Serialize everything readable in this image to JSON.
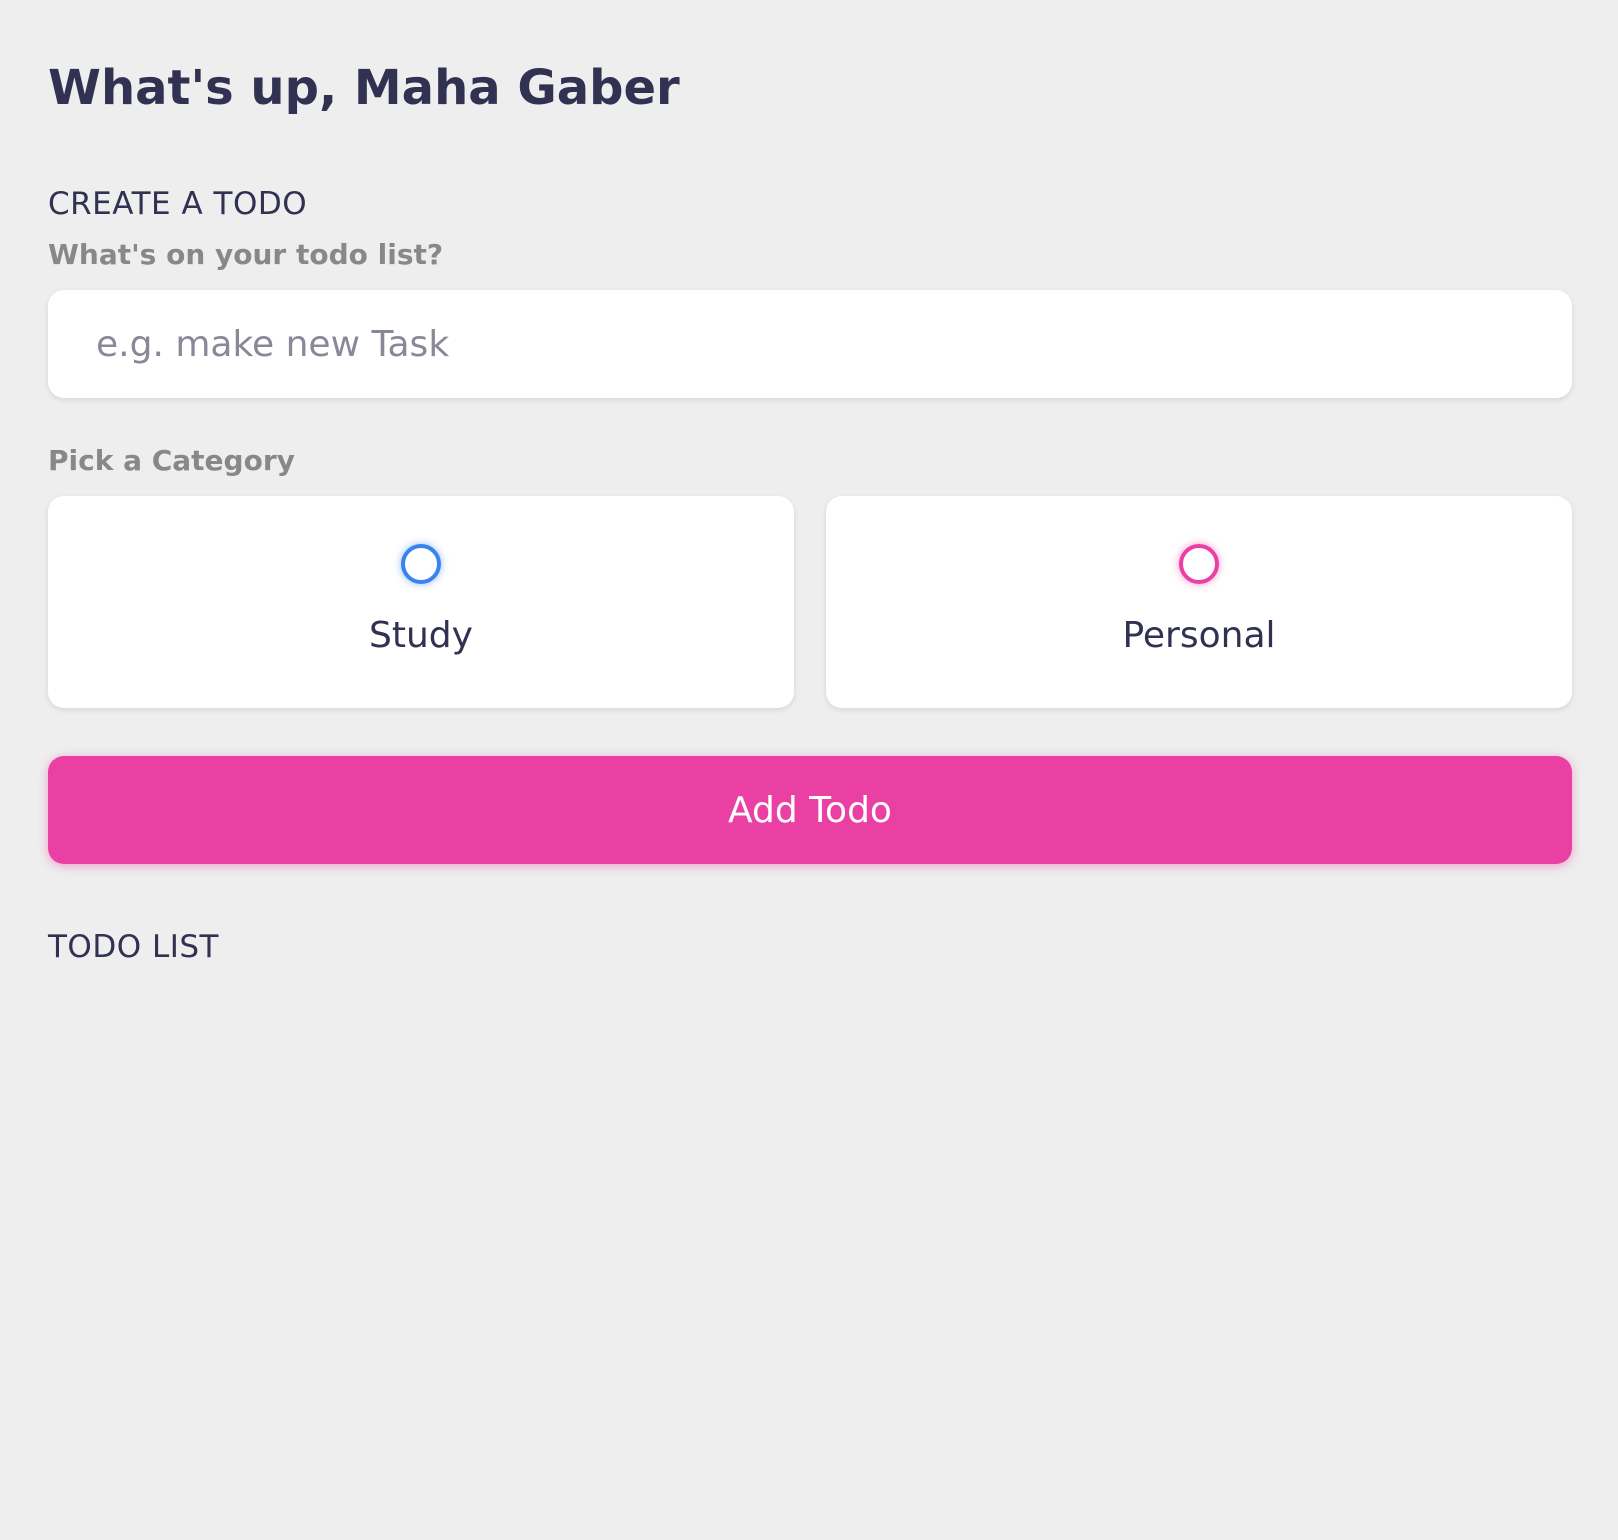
{
  "greeting": {
    "text": "What's up, Maha Gaber"
  },
  "create_section": {
    "title": "CREATE A TODO",
    "input_label": "What's on your todo list?",
    "input_value": "",
    "input_placeholder": "e.g. make new Task",
    "category_label": "Pick a Category",
    "categories": [
      {
        "label": "Study",
        "color": "#3a82ee",
        "selected": false
      },
      {
        "label": "Personal",
        "color": "#ea40a4",
        "selected": false
      }
    ],
    "add_button_label": "Add Todo"
  },
  "list_section": {
    "title": "TODO LIST",
    "items": []
  },
  "colors": {
    "background": "#eeeeee",
    "text": "#313151",
    "label": "#888888",
    "accent_pink": "#ea40a4",
    "accent_blue": "#3a82ee"
  }
}
